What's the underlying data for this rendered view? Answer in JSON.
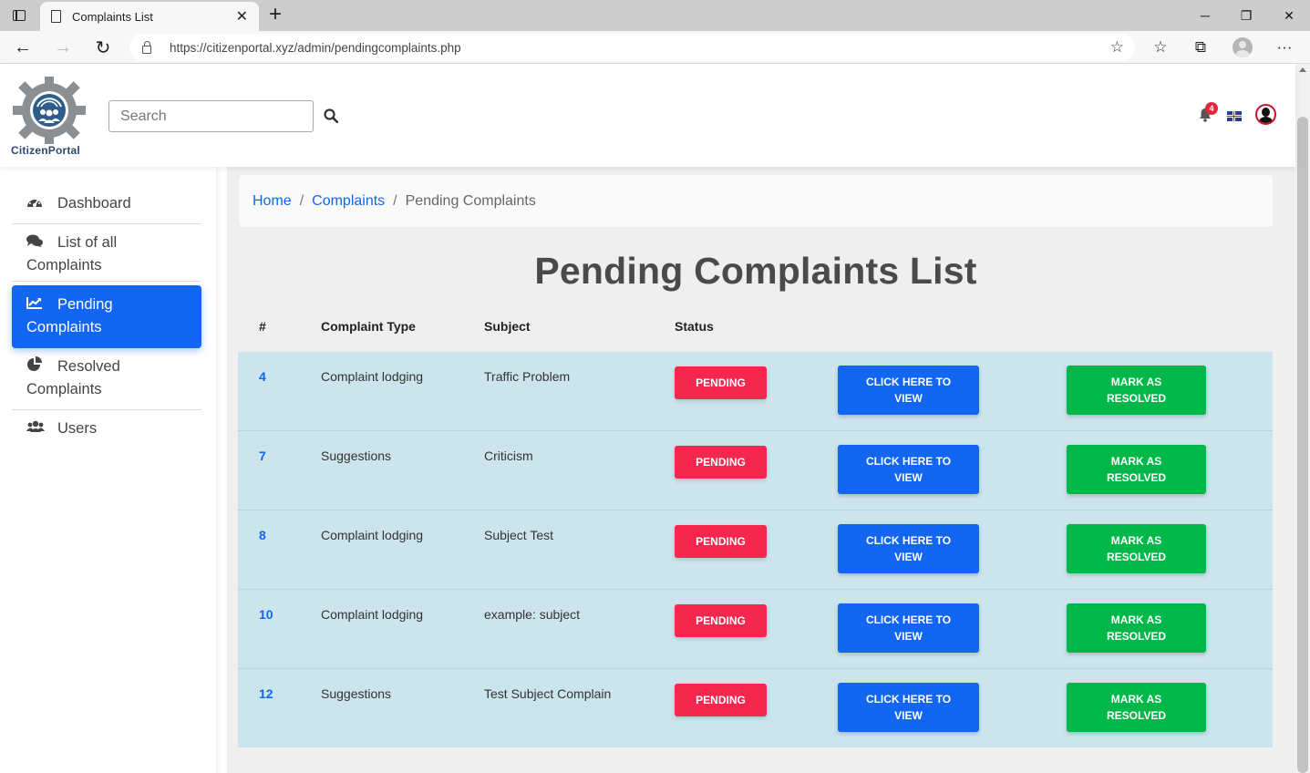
{
  "browser": {
    "tab_title": "Complaints List",
    "url": "https://citizenportal.xyz/admin/pendingcomplaints.php"
  },
  "header": {
    "brand": "CitizenPortal",
    "search_placeholder": "Search",
    "notification_count": "4"
  },
  "sidebar": {
    "items": [
      {
        "label": "Dashboard",
        "icon": "gauge-icon"
      },
      {
        "label": "List of all Complaints",
        "icon": "comments-icon"
      },
      {
        "label": "Pending Complaints",
        "icon": "chart-line-icon",
        "active": true
      },
      {
        "label": "Resolved Complaints",
        "icon": "pie-chart-icon"
      },
      {
        "label": "Users",
        "icon": "users-icon"
      }
    ]
  },
  "breadcrumb": {
    "home": "Home",
    "complaints": "Complaints",
    "current": "Pending Complaints",
    "separator": "/"
  },
  "page_title": "Pending Complaints List",
  "table": {
    "headers": [
      "#",
      "Complaint Type",
      "Subject",
      "Status"
    ],
    "status_label": "PENDING",
    "view_label": "CLICK HERE TO VIEW",
    "resolve_label": "MARK AS RESOLVED",
    "rows": [
      {
        "id": "4",
        "type": "Complaint lodging",
        "subject": "Traffic Problem"
      },
      {
        "id": "7",
        "type": "Suggestions",
        "subject": "Criticism"
      },
      {
        "id": "8",
        "type": "Complaint lodging",
        "subject": "Subject Test"
      },
      {
        "id": "10",
        "type": "Complaint lodging",
        "subject": "example: subject"
      },
      {
        "id": "12",
        "type": "Suggestions",
        "subject": "Test Subject Complain"
      }
    ]
  },
  "colors": {
    "primary": "#1266f1",
    "danger": "#f4284f",
    "success": "#00b74a",
    "row_bg": "#cce4ec"
  }
}
